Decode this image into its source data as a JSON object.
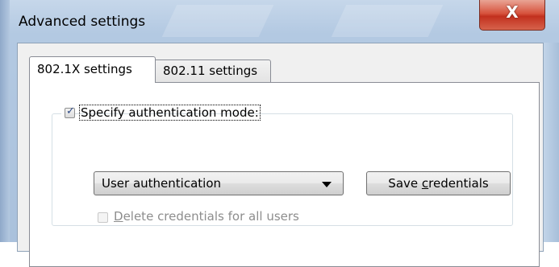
{
  "window": {
    "title": "Advanced settings",
    "close_glyph": "X"
  },
  "tabs": [
    {
      "label": "802.1X settings",
      "selected": true
    },
    {
      "label": "802.11 settings",
      "selected": false
    }
  ],
  "auth_group": {
    "specify_checkbox": {
      "label": "Specify authentication mode:",
      "checked": true,
      "tick_glyph": "✓"
    },
    "mode_select": {
      "selected": "User authentication"
    },
    "save_button": {
      "label_before": "Save ",
      "label_accel": "c",
      "label_after": "redentials"
    },
    "delete_checkbox": {
      "label_accel": "D",
      "label_rest": "elete credentials for all users",
      "checked": false,
      "enabled": false
    }
  },
  "colors": {
    "title_bar": "#b3c9e2",
    "close_button": "#c2301e",
    "tab_panel": "#ffffff",
    "disabled_text": "#8d8d8d"
  },
  "icons": {
    "close": "close-icon",
    "dropdown": "chevron-down-icon",
    "check": "checkmark-icon"
  }
}
